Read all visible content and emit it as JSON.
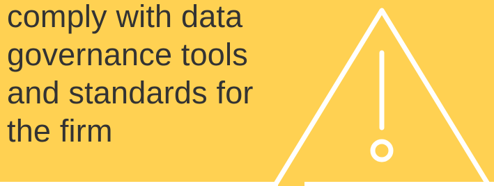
{
  "slide": {
    "text_lines": [
      "comply with data",
      "governance tools",
      "and standards for",
      "the firm"
    ],
    "colors": {
      "background": "#FFD152",
      "text": "#333333",
      "icon_stroke": "#FFFFFF"
    },
    "icon": "warning-triangle-icon"
  }
}
